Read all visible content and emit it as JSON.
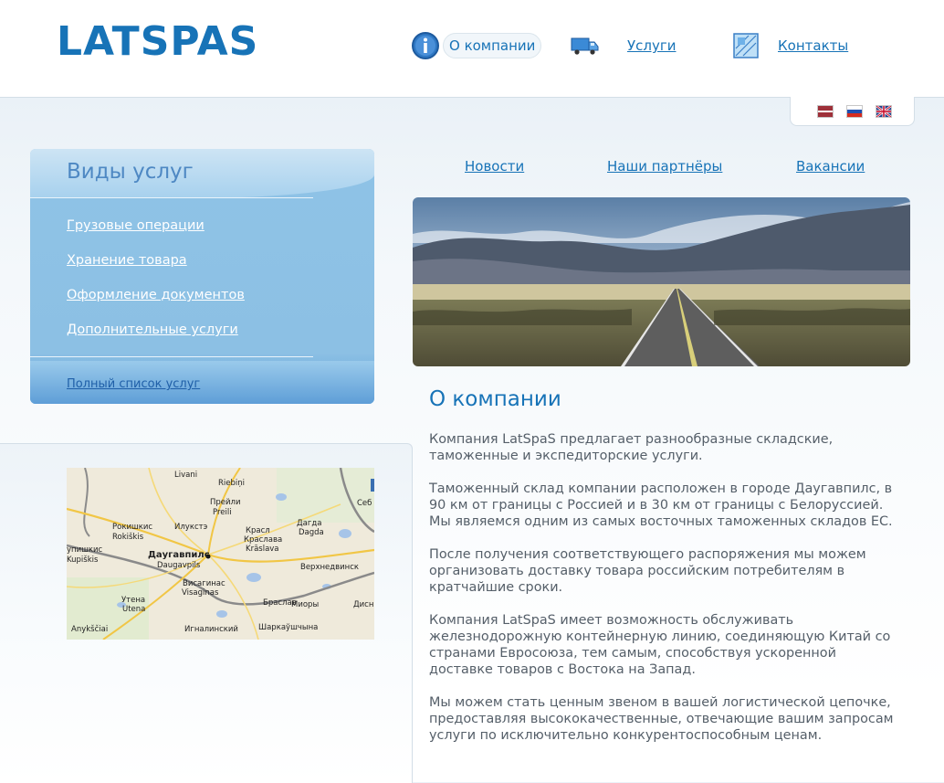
{
  "header": {
    "logo_text": "LATSPAS",
    "nav": [
      {
        "label": "О компании",
        "icon": "info-icon",
        "active": true
      },
      {
        "label": "Услуги",
        "icon": "truck-icon"
      },
      {
        "label": "Контакты",
        "icon": "contacts-icon"
      }
    ],
    "languages": [
      {
        "code": "lv",
        "icon": "flag-latvia-icon"
      },
      {
        "code": "ru",
        "icon": "flag-russia-icon"
      },
      {
        "code": "en",
        "icon": "flag-uk-icon"
      }
    ]
  },
  "services": {
    "title": "Виды услуг",
    "items": [
      "Грузовые операции",
      "Хранение товара",
      "Оформление документов",
      "Дополнительные услуги"
    ],
    "all_link": "Полный список услуг"
  },
  "map": {
    "labels": [
      "Рокишкис",
      "Rokiškis",
      "Илукстэ",
      "Прейли",
      "Preili",
      "Красл",
      "Краслава",
      "Krāslava",
      "Дагда",
      "Dagda",
      "Даугавпилс",
      "Daugavpils",
      "Висагинас",
      "Visaginas",
      "Верхнедвинск",
      "Браслав",
      "Миоры",
      "Утена",
      "Utena",
      "Игналинский",
      "Шаркаўшчына",
      "Kupiškis",
      "упишкис",
      "Livani",
      "Riebiņi",
      "Anykščiai",
      "Дисн",
      "Себ",
      "Dagda"
    ]
  },
  "subnav": [
    "Новости",
    "Наши партнёры",
    "Вакансии"
  ],
  "about": {
    "title": "О компании",
    "paragraphs": [
      "Компания LatSpaS предлагает разнообразные складские, таможенные и экспедиторские услуги.",
      "Таможенный склад компании расположен в городе Даугавпилс, в 90 км от границы с Россией и в 30 км от границы с Белоруссией. Мы являемся одним из самых восточных таможенных складов ЕС.",
      "После получения соответствующего распоряжения мы можем организовать доставку товара российским потребителям в кратчайшие сроки.",
      "Компания LatSpaS имеет возможность обслуживать железнодорожную контейнерную линию, соединяющую Китай со странами Евросоюза, тем самым, способствуя ускоренной доставке товаров с Востока на Запад.",
      "Мы можем стать ценным звеном в вашей логистической цепочке, предоставляя высококачественные, отвечающие вашим запросам услуги по исключительно конкурентоспособным ценам."
    ]
  },
  "colors": {
    "brand": "#1773b7",
    "panel": "#8cc0e4"
  }
}
